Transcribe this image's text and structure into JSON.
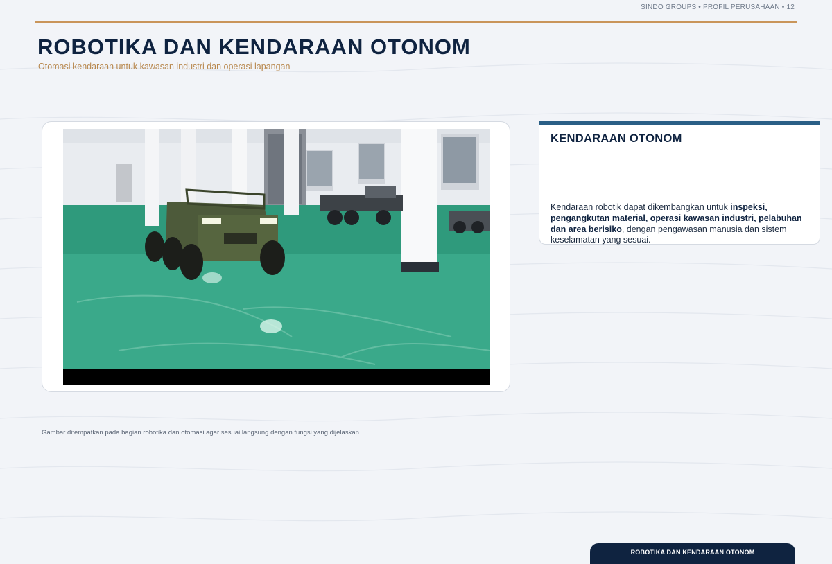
{
  "header": {
    "meta": "SINDO GROUPS • PROFIL PERUSAHAAN • 12"
  },
  "page": {
    "title": "ROBOTIKA DAN KENDARAAN OTONOM",
    "subtitle": "Otomasi kendaraan untuk kawasan industri dan operasi lapangan"
  },
  "info_card": {
    "title": "KENDARAAN OTONOM",
    "body_intro": "Kendaraan robotik dapat dikembangkan untuk ",
    "body_bold": "inspeksi, pengangkutan material, operasi kawasan industri, pelabuhan dan area berisiko",
    "body_outro": ", dengan pengawasan manusia dan sistem keselamatan yang sesuai."
  },
  "caption": "Gambar ditempatkan pada bagian robotika dan otomasi agar sesuai langsung dengan fungsi yang dijelaskan.",
  "footer": {
    "tab_label": "ROBOTIKA DAN KENDARAAN OTONOM"
  },
  "colors": {
    "navy": "#0f2340",
    "accent_gold": "#c9955a",
    "card_top_bar": "#2a5f86",
    "floor_green": "#2f9a7c"
  }
}
